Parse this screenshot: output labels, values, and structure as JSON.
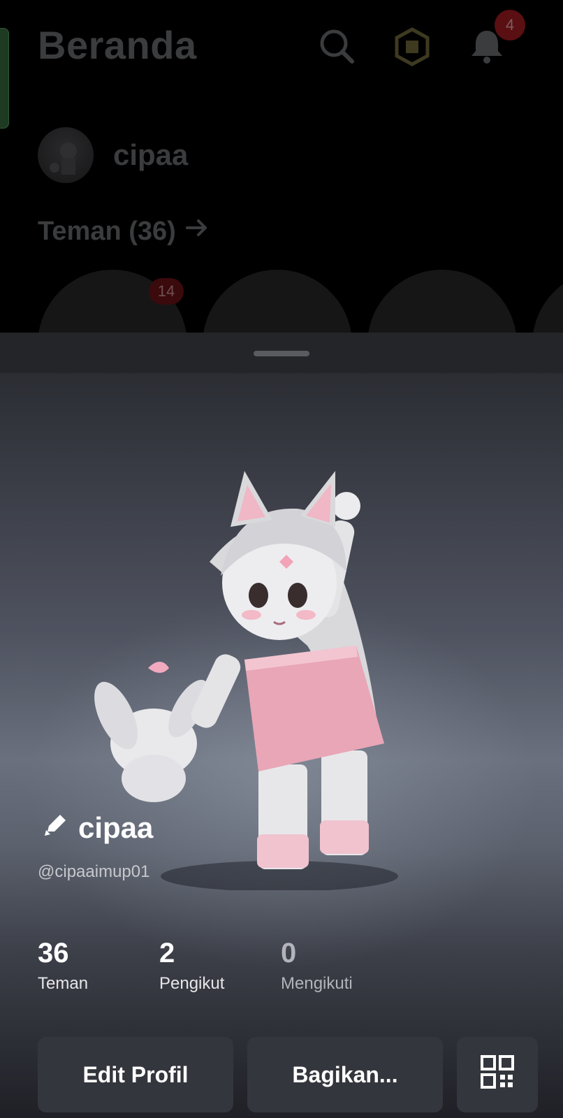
{
  "header": {
    "title": "Beranda",
    "search_icon": "search-icon",
    "robux_icon": "robux-icon",
    "notifications_icon": "bell-icon",
    "notifications_count": "4"
  },
  "home": {
    "username": "cipaa",
    "friends_link": "Teman (36)",
    "friend_request_badge": "14"
  },
  "profile": {
    "display_name": "cipaa",
    "handle": "@cipaaimup01",
    "edit_icon": "pencil-icon",
    "stats": [
      {
        "value": "36",
        "label": "Teman"
      },
      {
        "value": "2",
        "label": "Pengikut"
      },
      {
        "value": "0",
        "label": "Mengikuti"
      }
    ]
  },
  "actions": {
    "edit_label": "Edit Profil",
    "share_label": "Bagikan...",
    "qr_icon": "qr-code-icon"
  },
  "colors": {
    "sheet_bg": "#212228",
    "button_bg": "#34363d",
    "badge_red": "#5a0f12"
  }
}
